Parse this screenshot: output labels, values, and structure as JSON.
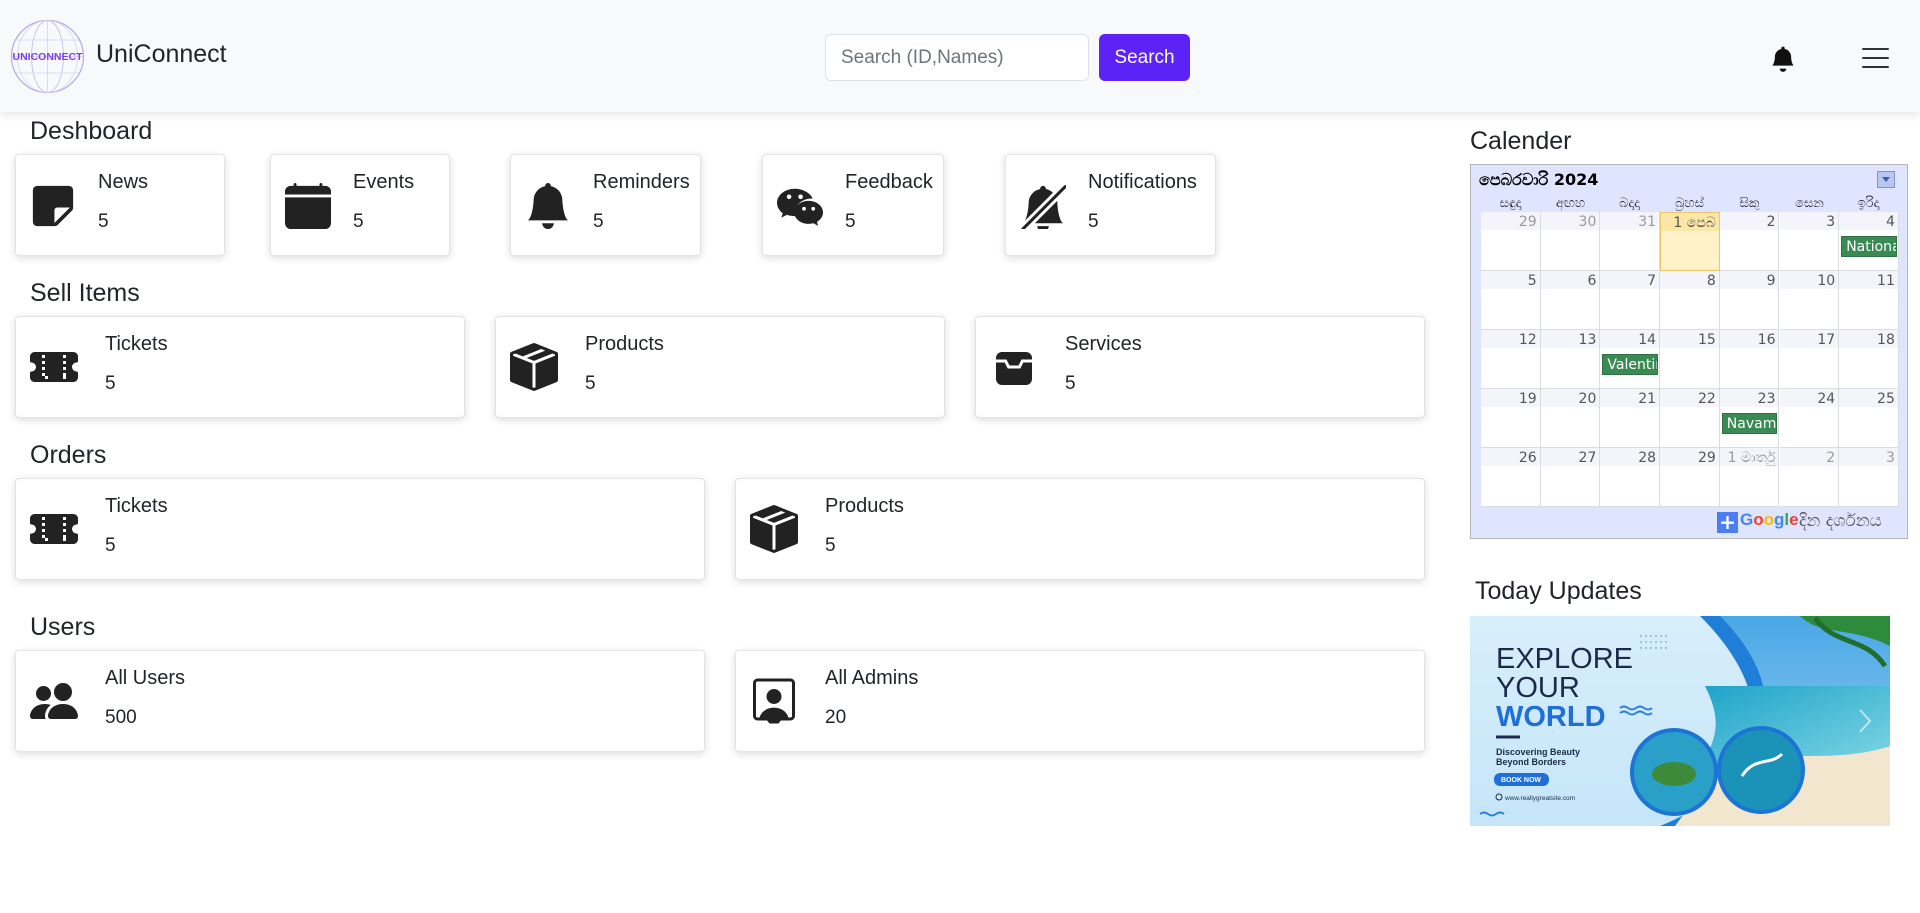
{
  "navbar": {
    "logo_text": "UNICONNECT",
    "brand": "UniConnect",
    "search_placeholder": "Search (ID,Names)",
    "search_button": "Search"
  },
  "dashboard": {
    "title": "Deshboard",
    "cards": [
      {
        "label": "News",
        "count": "5",
        "icon": "note-icon"
      },
      {
        "label": "Events",
        "count": "5",
        "icon": "calendar-icon"
      },
      {
        "label": "Reminders",
        "count": "5",
        "icon": "bell-icon"
      },
      {
        "label": "Feedback",
        "count": "5",
        "icon": "chat-icon"
      },
      {
        "label": "Notifications",
        "count": "5",
        "icon": "bell-slash-icon"
      }
    ]
  },
  "sell_items": {
    "title": "Sell Items",
    "cards": [
      {
        "label": "Tickets",
        "count": "5",
        "icon": "ticket-icon"
      },
      {
        "label": "Products",
        "count": "5",
        "icon": "box-icon"
      },
      {
        "label": "Services",
        "count": "5",
        "icon": "tray-icon"
      }
    ]
  },
  "orders": {
    "title": "Orders",
    "cards": [
      {
        "label": "Tickets",
        "count": "5",
        "icon": "ticket-icon"
      },
      {
        "label": "Products",
        "count": "5",
        "icon": "box-icon"
      }
    ]
  },
  "users": {
    "title": "Users",
    "cards": [
      {
        "label": "All Users",
        "count": "500",
        "icon": "people-icon"
      },
      {
        "label": "All Admins",
        "count": "20",
        "icon": "person-badge-icon"
      }
    ]
  },
  "calendar": {
    "title": "Calender",
    "month": "පෙබරවාරි 2024",
    "weekdays": [
      "සඳුදා",
      "අඟහ",
      "බදාදා",
      "බ්‍රහස්",
      "සිකු",
      "සෙන",
      "ඉරිදා"
    ],
    "weeks": [
      [
        "29",
        "30",
        "31",
        "1 පෙබ",
        "2",
        "3",
        "4"
      ],
      [
        "5",
        "6",
        "7",
        "8",
        "9",
        "10",
        "11"
      ],
      [
        "12",
        "13",
        "14",
        "15",
        "16",
        "17",
        "18"
      ],
      [
        "19",
        "20",
        "21",
        "22",
        "23",
        "24",
        "25"
      ],
      [
        "26",
        "27",
        "28",
        "29",
        "1 මාර්තු",
        "2",
        "3"
      ]
    ],
    "events": [
      {
        "week": 0,
        "day": 6,
        "label": "Nationa"
      },
      {
        "week": 2,
        "day": 2,
        "label": "Valentin"
      },
      {
        "week": 3,
        "day": 4,
        "label": "Navam"
      }
    ],
    "google": "Google",
    "view_in": "දින දර්ශනය"
  },
  "today_updates": {
    "title": "Today Updates",
    "banner": {
      "line1": "EXPLORE",
      "line2": "YOUR",
      "line3": "WORLD",
      "tagline1": "Discovering Beauty",
      "tagline2": "Beyond Borders",
      "cta": "BOOK NOW",
      "site": "www.reallygreatsite.com"
    }
  }
}
